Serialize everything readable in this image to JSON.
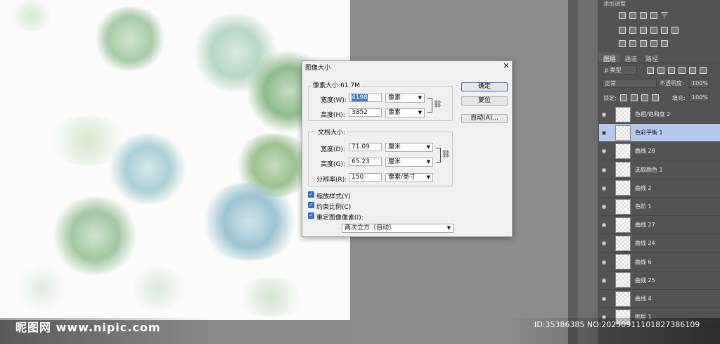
{
  "adjustments": {
    "title": "添加调整"
  },
  "layers_panel": {
    "tabs": [
      "图层",
      "通道",
      "路径"
    ],
    "filter_label": "ρ 类型",
    "blend_mode": "正常",
    "opacity_label": "不透明度:",
    "opacity_value": "100%",
    "lock_label": "锁定:",
    "fill_label": "填充:",
    "fill_value": "100%",
    "layers": [
      {
        "name": "色相/饱和度 2",
        "selected": false
      },
      {
        "name": "色彩平衡 1",
        "selected": true
      },
      {
        "name": "曲线 28",
        "selected": false
      },
      {
        "name": "选取颜色 1",
        "selected": false
      },
      {
        "name": "曲线 2",
        "selected": false
      },
      {
        "name": "色阶 1",
        "selected": false
      },
      {
        "name": "曲线 27",
        "selected": false
      },
      {
        "name": "曲线 24",
        "selected": false
      },
      {
        "name": "曲线 6",
        "selected": false
      },
      {
        "name": "曲线 25",
        "selected": false
      },
      {
        "name": "曲线 4",
        "selected": false
      },
      {
        "name": "图层 1",
        "selected": false
      }
    ]
  },
  "dialog": {
    "title": "图像大小",
    "pixel_group": {
      "title": "像素大小:61.7M",
      "width_label": "宽度(W):",
      "width_value": "4198",
      "width_unit": "像素",
      "height_label": "高度(H):",
      "height_value": "3852",
      "height_unit": "像素"
    },
    "doc_group": {
      "title": "文档大小:",
      "width_label": "宽度(D):",
      "width_value": "71.09",
      "width_unit": "厘米",
      "height_label": "高度(G):",
      "height_value": "65.23",
      "height_unit": "厘米",
      "res_label": "分辨率(R):",
      "res_value": "150",
      "res_unit": "像素/英寸"
    },
    "checkboxes": [
      "缩放样式(Y)",
      "约束比例(C)",
      "重定图像像素(I):"
    ],
    "resample_method": "两次立方（自动）",
    "buttons": {
      "ok": "确定",
      "reset": "复位",
      "auto": "自动(A)..."
    }
  },
  "watermark": {
    "site": "昵图网 www.nipic.com",
    "id_text": "ID:35386385 NO:20250911101827386109"
  },
  "colors": {
    "selected_layer": "#b5c9ee",
    "accent": "#2f6fcf",
    "panel_bg": "#535353"
  }
}
